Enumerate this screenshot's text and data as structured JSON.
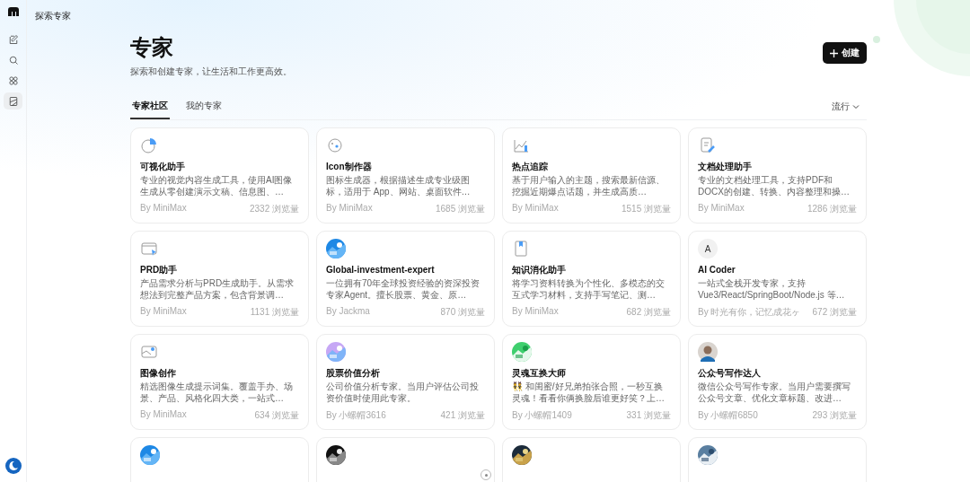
{
  "sidebar": {
    "items": [
      {
        "selected": false
      },
      {
        "selected": false
      },
      {
        "selected": false
      },
      {
        "selected": true
      }
    ]
  },
  "breadcrumb": "探索专家",
  "header": {
    "title": "专家",
    "subtitle": "探索和创建专家，让生活和工作更高效。",
    "create_button": "创建"
  },
  "tabs": [
    {
      "label": "专家社区",
      "selected": true
    },
    {
      "label": "我的专家",
      "selected": false
    }
  ],
  "sort": "流行",
  "cards": [
    {
      "kind": "line-icon",
      "title": "可视化助手",
      "description": "专业的视觉内容生成工具，使用AI图像生成从零创建演示文稿、信息图、…",
      "author": "By MiniMax",
      "views": "2332 浏览量"
    },
    {
      "kind": "line-icon",
      "title": "Icon制作器",
      "description": "图标生成器，根据描述生成专业级图标，适用于 App、网站、桌面软件…",
      "author": "By MiniMax",
      "views": "1685 浏览量"
    },
    {
      "kind": "line-icon",
      "title": "热点追踪",
      "description": "基于用户输入的主题，搜索最新信源、挖掘近期爆点话题，并生成高质…",
      "author": "By MiniMax",
      "views": "1515 浏览量"
    },
    {
      "kind": "line-icon",
      "title": "文档处理助手",
      "description": "专业的文档处理工具，支持PDF和DOCX的创建、转换、内容整理和操…",
      "author": "By MiniMax",
      "views": "1286 浏览量"
    },
    {
      "kind": "line-icon",
      "title": "PRD助手",
      "description": "产品需求分析与PRD生成助手。从需求想法到完整产品方案，包含背景调…",
      "author": "By MiniMax",
      "views": "1131 浏览量"
    },
    {
      "kind": "picture",
      "title": "Global-investment-expert",
      "description": "一位拥有70年全球投资经验的资深投资专家Agent。擅长股票、黄金、原…",
      "author": "By Jackma",
      "views": "870 浏览量"
    },
    {
      "kind": "line-icon",
      "title": "知识消化助手",
      "description": "将学习资料转换为个性化、多模态的交互式学习材料，支持手写笔记、测…",
      "author": "By MiniMax",
      "views": "682 浏览量"
    },
    {
      "kind": "letter",
      "letter": "A",
      "title": "AI Coder",
      "description": "一站式全栈开发专家，支持Vue3/React/SpringBoot/Node.js 等…",
      "author": "By 时光有你，记忆成花ヶ",
      "views": "672 浏览量"
    },
    {
      "kind": "line-icon",
      "title": "图像创作",
      "description": "精选图像生成提示词集。覆盖手办、场景、产品、风格化四大类，一站式…",
      "author": "By MiniMax",
      "views": "634 浏览量"
    },
    {
      "kind": "picture",
      "title": "股票价值分析",
      "description": "公司价值分析专家。当用户评估公司投资价值时使用此专家。",
      "author": "By 小螺帽3616",
      "views": "421 浏览量"
    },
    {
      "kind": "picture",
      "title": "灵魂互换大师",
      "description": "👯 和闺蜜/好兄弟拍张合照，一秒互换灵魂！看看你俩换脸后谁更好笑？上…",
      "author": "By 小螺帽1409",
      "views": "331 浏览量"
    },
    {
      "kind": "avatar",
      "title": "公众号写作达人",
      "description": "微信公众号写作专家。当用户需要撰写公众号文章、优化文章标题、改进…",
      "author": "By 小螺帽6850",
      "views": "293 浏览量"
    },
    {
      "kind": "picture"
    },
    {
      "kind": "picture"
    },
    {
      "kind": "picture"
    },
    {
      "kind": "picture"
    }
  ]
}
